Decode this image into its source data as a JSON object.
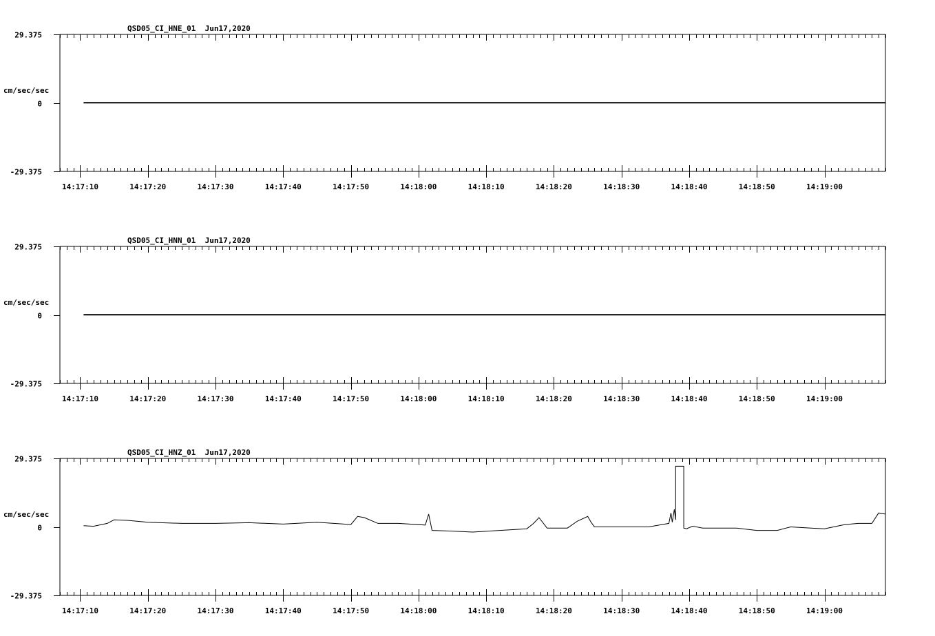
{
  "chart_data": [
    {
      "type": "line",
      "title": "QSD05_CI_HNE_01  Jun17,2020",
      "ylabel": "cm/sec/sec",
      "ylim": [
        -29.375,
        29.375
      ],
      "ytick_labels": [
        "29.375",
        "0",
        "-29.375"
      ],
      "xlim": [
        "14:17:07",
        "14:19:09"
      ],
      "xtick_labels": [
        "14:17:10",
        "14:17:20",
        "14:17:30",
        "14:17:40",
        "14:17:50",
        "14:18:00",
        "14:18:10",
        "14:18:20",
        "14:18:30",
        "14:18:40",
        "14:18:50",
        "14:19:00"
      ],
      "series": [
        {
          "x": [
            "14:17:10.5",
            "14:19:09"
          ],
          "y": [
            0.1,
            0.1
          ]
        }
      ]
    },
    {
      "type": "line",
      "title": "QSD05_CI_HNN_01  Jun17,2020",
      "ylabel": "cm/sec/sec",
      "ylim": [
        -29.375,
        29.375
      ],
      "ytick_labels": [
        "29.375",
        "0",
        "-29.375"
      ],
      "xlim": [
        "14:17:07",
        "14:19:09"
      ],
      "xtick_labels": [
        "14:17:10",
        "14:17:20",
        "14:17:30",
        "14:17:40",
        "14:17:50",
        "14:18:00",
        "14:18:10",
        "14:18:20",
        "14:18:30",
        "14:18:40",
        "14:18:50",
        "14:19:00"
      ],
      "series": [
        {
          "x": [
            "14:17:10.5",
            "14:19:09"
          ],
          "y": [
            0.1,
            0.1
          ]
        }
      ]
    },
    {
      "type": "line",
      "title": "QSD05_CI_HNZ_01  Jun17,2020",
      "ylabel": "cm/sec/sec",
      "ylim": [
        -29.375,
        29.375
      ],
      "ytick_labels": [
        "29.375",
        "0",
        "-29.375"
      ],
      "xlim": [
        "14:17:07",
        "14:19:09"
      ],
      "xtick_labels": [
        "14:17:10",
        "14:17:20",
        "14:17:30",
        "14:17:40",
        "14:17:50",
        "14:18:00",
        "14:18:10",
        "14:18:20",
        "14:18:30",
        "14:18:40",
        "14:18:50",
        "14:19:00"
      ],
      "series": [
        {
          "x": [
            "14:17:10.5",
            "14:17:12",
            "14:17:14",
            "14:17:15",
            "14:17:17",
            "14:17:20",
            "14:17:25",
            "14:17:30",
            "14:17:35",
            "14:17:40",
            "14:17:45",
            "14:17:50",
            "14:17:51",
            "14:17:52",
            "14:17:54",
            "14:17:57",
            "14:18:01",
            "14:18:01.5",
            "14:18:02",
            "14:18:05",
            "14:18:08",
            "14:18:12",
            "14:18:16",
            "14:18:17",
            "14:18:17.8",
            "14:18:19",
            "14:18:22",
            "14:18:23.5",
            "14:18:25",
            "14:18:25.5",
            "14:18:26",
            "14:18:30",
            "14:18:34",
            "14:18:37",
            "14:18:37.3",
            "14:18:37.5",
            "14:18:37.8",
            "14:18:38",
            "14:18:38",
            "14:18:39.2",
            "14:18:39.2",
            "14:18:39.6",
            "14:18:40.5",
            "14:18:42",
            "14:18:45",
            "14:18:47",
            "14:18:50",
            "14:18:53",
            "14:18:55",
            "14:18:58",
            "14:19:00",
            "14:19:03",
            "14:19:05",
            "14:19:07",
            "14:19:08",
            "14:19:09"
          ],
          "y": [
            0.5,
            0.3,
            1.5,
            3.0,
            2.8,
            2.0,
            1.5,
            1.5,
            1.8,
            1.2,
            2.0,
            1.0,
            4.5,
            4.0,
            1.5,
            1.5,
            0.8,
            5.5,
            -1.5,
            -1.8,
            -2.2,
            -1.5,
            -0.8,
            1.5,
            4.0,
            -0.5,
            -0.5,
            2.5,
            4.5,
            2.0,
            0.0,
            0.0,
            0.0,
            1.5,
            6.0,
            2.0,
            7.5,
            3.0,
            26.0,
            26.0,
            -0.5,
            -0.8,
            0.3,
            -0.5,
            -0.5,
            -0.5,
            -1.5,
            -1.5,
            0.0,
            -0.5,
            -0.8,
            1.0,
            1.5,
            1.5,
            6.0,
            5.5
          ]
        }
      ]
    }
  ]
}
